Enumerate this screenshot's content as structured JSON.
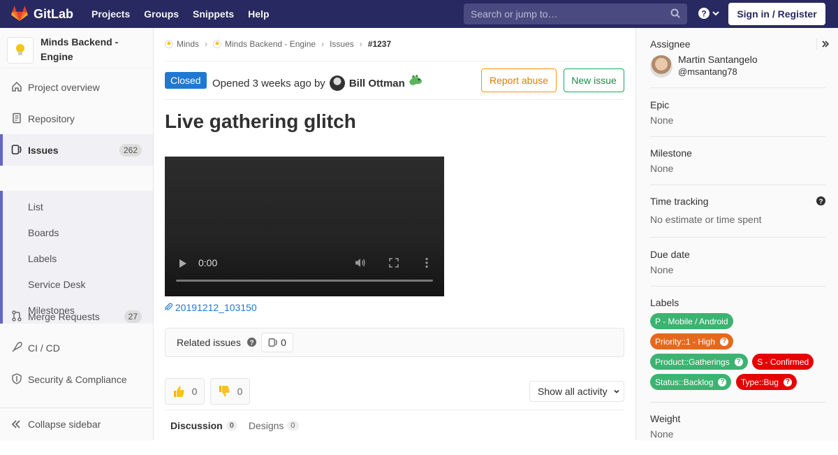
{
  "nav": {
    "brand": "GitLab",
    "links": [
      "Projects",
      "Groups",
      "Snippets",
      "Help"
    ],
    "search_placeholder": "Search or jump to…",
    "signin": "Sign in / Register"
  },
  "sidebar": {
    "project_name_line1": "Minds Backend -",
    "project_name_line2": "Engine",
    "items": [
      {
        "label": "Project overview",
        "icon": "home-icon"
      },
      {
        "label": "Repository",
        "icon": "doc-text-icon"
      },
      {
        "label": "Issues",
        "icon": "issues-icon",
        "count": "262"
      },
      {
        "label": "Merge Requests",
        "icon": "git-merge-icon",
        "count": "27"
      },
      {
        "label": "CI / CD",
        "icon": "rocket-icon"
      },
      {
        "label": "Security & Compliance",
        "icon": "shield-icon"
      }
    ],
    "issues_sub": [
      "List",
      "Boards",
      "Labels",
      "Service Desk",
      "Milestones"
    ],
    "collapse": "Collapse sidebar"
  },
  "breadcrumb": [
    "Minds",
    "Minds Backend - Engine",
    "Issues",
    "#1237"
  ],
  "issue": {
    "status": "Closed",
    "opened_text": "Opened",
    "opened_time": "3 weeks ago",
    "by": "by",
    "author": "Bill Ottman",
    "report_abuse": "Report abuse",
    "new_issue": "New issue",
    "title": "Live gathering glitch",
    "video_time": "0:00",
    "attachment": "20191212_103150",
    "related_label": "Related issues",
    "related_count": "0",
    "thumbs_up": "0",
    "thumbs_down": "0",
    "activity_filter": "Show all activity"
  },
  "tabs": [
    {
      "label": "Discussion",
      "count": "0"
    },
    {
      "label": "Designs",
      "count": "0"
    }
  ],
  "right": {
    "assignee_title": "Assignee",
    "assignee_name": "Martin Santangelo",
    "assignee_handle": "@msantang78",
    "epic_title": "Epic",
    "epic_value": "None",
    "milestone_title": "Milestone",
    "milestone_value": "None",
    "time_title": "Time tracking",
    "time_value": "No estimate or time spent",
    "due_title": "Due date",
    "due_value": "None",
    "labels_title": "Labels",
    "labels": [
      {
        "text": "P - Mobile / Android",
        "color": "#3cb371"
      },
      {
        "text": "Priority::1 - High",
        "color": "#e5691c"
      },
      {
        "text": "Product::Gatherings",
        "color": "#3cb371"
      },
      {
        "text": "S - Confirmed",
        "color": "#e60000"
      },
      {
        "text": "Status::Backlog",
        "color": "#3cb371"
      },
      {
        "text": "Type::Bug",
        "color": "#e60000"
      }
    ],
    "weight_title": "Weight",
    "weight_value": "None"
  }
}
